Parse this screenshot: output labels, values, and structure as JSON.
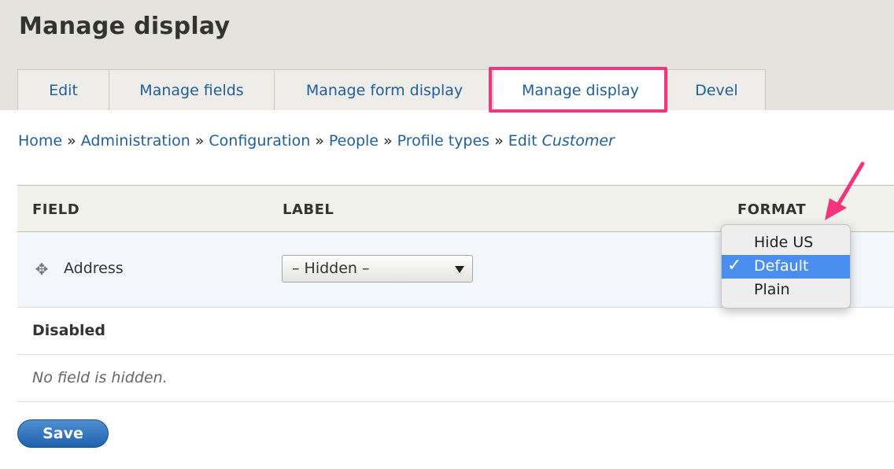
{
  "page": {
    "title": "Manage display"
  },
  "tabs": [
    {
      "label": "Edit",
      "active": false
    },
    {
      "label": "Manage fields",
      "active": false
    },
    {
      "label": "Manage form display",
      "active": false
    },
    {
      "label": "Manage display",
      "active": true
    },
    {
      "label": "Devel",
      "active": false
    }
  ],
  "breadcrumb": {
    "items": [
      "Home",
      "Administration",
      "Configuration",
      "People",
      "Profile types"
    ],
    "separator": "»",
    "current_prefix": "Edit",
    "current_name": "Customer"
  },
  "table": {
    "headers": {
      "field": "FIELD",
      "label": "LABEL",
      "format": "FORMAT"
    },
    "rows": [
      {
        "field": "Address",
        "label_select": "– Hidden –"
      }
    ],
    "disabled_section": "Disabled",
    "empty_message": "No field is hidden."
  },
  "format_dropdown": {
    "options": [
      "Hide US",
      "Default",
      "Plain"
    ],
    "selected": "Default",
    "check_glyph": "✓"
  },
  "actions": {
    "save_label": "Save"
  },
  "colors": {
    "link": "#1f5e99",
    "highlight_annotation": "#f4347d",
    "save_button": "#2a6ab8",
    "dropdown_selected": "#4a8ef0"
  }
}
